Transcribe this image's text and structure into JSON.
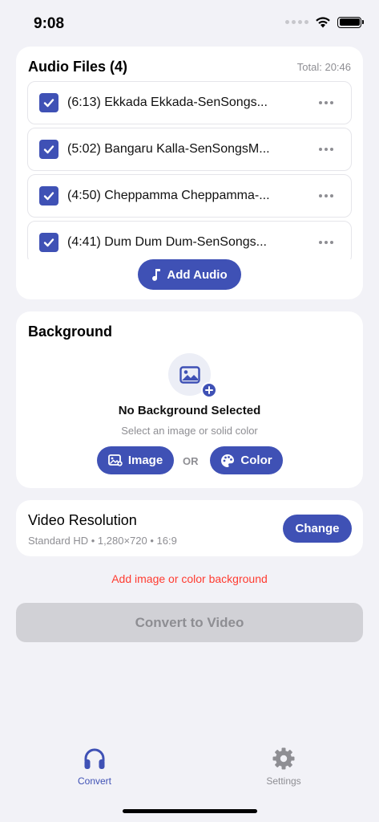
{
  "status": {
    "time": "9:08"
  },
  "audio": {
    "title": "Audio Files (4)",
    "total": "Total: 20:46",
    "items": [
      {
        "label": "(6:13) Ekkada Ekkada-SenSongs...",
        "checked": true
      },
      {
        "label": "(5:02) Bangaru Kalla-SenSongsM...",
        "checked": true
      },
      {
        "label": "(4:50) Cheppamma Cheppamma-...",
        "checked": true
      },
      {
        "label": "(4:41) Dum Dum Dum-SenSongs...",
        "checked": true
      }
    ],
    "add_label": "Add Audio"
  },
  "background": {
    "title": "Background",
    "status": "No Background Selected",
    "hint": "Select an image or solid color",
    "image_label": "Image",
    "or_label": "OR",
    "color_label": "Color"
  },
  "resolution": {
    "title": "Video Resolution",
    "detail": "Standard HD • 1,280×720 • 16:9",
    "change_label": "Change"
  },
  "warning": "Add image or color background",
  "convert_label": "Convert to Video",
  "tabs": [
    {
      "label": "Convert",
      "icon": "headphones-icon",
      "active": true
    },
    {
      "label": "Settings",
      "icon": "gear-icon",
      "active": false
    }
  ],
  "colors": {
    "accent": "#3f51b5",
    "warning": "#ff3b30",
    "disabled": "#d1d1d6"
  }
}
